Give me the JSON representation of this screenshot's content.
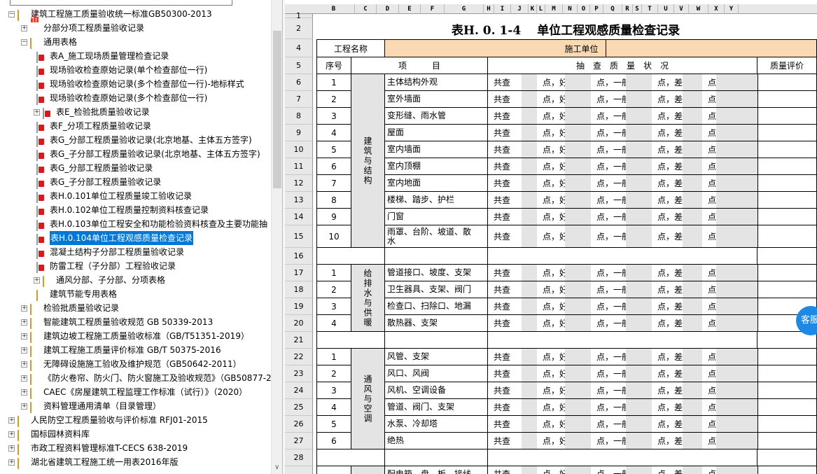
{
  "tree": {
    "toolbar_icons": [
      "search-icon",
      "dropdown-icon"
    ],
    "items": [
      {
        "label": "建筑工程施工质量验收统一标准GB50300-2013",
        "icon": "folder-icon",
        "exp": "−",
        "level": 1
      },
      {
        "label": "分部分项工程质量验收记录",
        "icon": "chart-icon",
        "exp": "+",
        "level": 2
      },
      {
        "label": "通用表格",
        "icon": "folder-icon",
        "exp": "−",
        "level": 2
      },
      {
        "label": "表A_施工现场质量管理检查记录",
        "icon": "pdf-icon",
        "exp": "",
        "level": 3
      },
      {
        "label": "现场验收检查原始记录(单个检查部位一行)",
        "icon": "pdf-icon",
        "exp": "",
        "level": 3
      },
      {
        "label": "现场验收检查原始记录(多个检查部位一行)-地标样式",
        "icon": "pdf-icon",
        "exp": "",
        "level": 3
      },
      {
        "label": "现场验收检查原始记录(多个检查部位一行)",
        "icon": "pdf-icon",
        "exp": "",
        "level": 3
      },
      {
        "label": "表E_检验批质量验收记录",
        "icon": "pdf-icon",
        "exp": "+",
        "level": 3
      },
      {
        "label": "表F_分项工程质量验收记录",
        "icon": "pdf-icon",
        "exp": "",
        "level": 3
      },
      {
        "label": "表G_分部工程质量验收记录(北京地基、主体五方签字)",
        "icon": "pdf-icon",
        "exp": "",
        "level": 3
      },
      {
        "label": "表G_子分部工程质量验收记录(北京地基、主体五方签字)",
        "icon": "pdf-icon",
        "exp": "",
        "level": 3
      },
      {
        "label": "表G_分部工程质量验收记录",
        "icon": "pdf-icon",
        "exp": "",
        "level": 3
      },
      {
        "label": "表G_子分部工程质量验收记录",
        "icon": "pdf-icon",
        "exp": "",
        "level": 3
      },
      {
        "label": "表H.0.101单位工程质量竣工验收记录",
        "icon": "pdf-icon",
        "exp": "",
        "level": 3
      },
      {
        "label": "表H.0.102单位工程质量控制资料核查记录",
        "icon": "pdf-icon",
        "exp": "",
        "level": 3
      },
      {
        "label": "表H.0.103单位工程安全和功能检验资料核查及主要功能抽",
        "icon": "pdf-icon",
        "exp": "",
        "level": 3
      },
      {
        "label": "表H.0.104单位工程观感质量检查记录",
        "icon": "pdf-icon",
        "exp": "",
        "level": 3,
        "selected": true
      },
      {
        "label": "混凝土结构子分部工程质量验收记录",
        "icon": "pdf-icon",
        "exp": "",
        "level": 3
      },
      {
        "label": "防雷工程（子分部）工程验收记录",
        "icon": "pdf-icon",
        "exp": "",
        "level": 3
      },
      {
        "label": "通风分部、子分部、分项表格",
        "icon": "folder-icon",
        "exp": "+",
        "level": 3
      },
      {
        "label": "建筑节能专用表格",
        "icon": "folder-icon",
        "exp": "",
        "level": 3
      },
      {
        "label": "检验批质量验收记录",
        "icon": "folder-icon",
        "exp": "+",
        "level": 2
      },
      {
        "label": "智能建筑工程质量验收规范 GB 50339-2013",
        "icon": "folder-icon",
        "exp": "+",
        "level": 2
      },
      {
        "label": "建筑边坡工程施工质量验收标准（GB/T51351-2019）",
        "icon": "folder-icon",
        "exp": "+",
        "level": 2
      },
      {
        "label": "建筑工程施工质量评价标准 GB/T 50375-2016",
        "icon": "folder-icon",
        "exp": "+",
        "level": 2
      },
      {
        "label": "无障碍设施施工验收及维护规范（GB50642-2011）",
        "icon": "folder-icon",
        "exp": "+",
        "level": 2
      },
      {
        "label": "《防火卷帘、防火门、防火窗施工及验收规范》（GB50877-2",
        "icon": "folder-icon",
        "exp": "+",
        "level": 2
      },
      {
        "label": "CAEC《房屋建筑工程监理工作标准（试行）》（2020）",
        "icon": "folder-icon",
        "exp": "+",
        "level": 2
      },
      {
        "label": "资料管理通用清单（目录管理）",
        "icon": "folder-icon",
        "exp": "+",
        "level": 2
      },
      {
        "label": "人民防空工程质量验收与评价标准 RFJ01-2015",
        "icon": "folder-icon",
        "exp": "+",
        "level": 1
      },
      {
        "label": "国标园林资料库",
        "icon": "folder-icon",
        "exp": "+",
        "level": 1
      },
      {
        "label": "市政工程资料管理标准T-CECS 638-2019",
        "icon": "folder-icon",
        "exp": "+",
        "level": 1
      },
      {
        "label": "湖北省建筑工程施工统一用表2016年版",
        "icon": "folder-icon",
        "exp": "+",
        "level": 1
      }
    ]
  },
  "sheet": {
    "columns": [
      "B",
      "C",
      "D",
      "E",
      "F",
      "G",
      "H",
      "I",
      "J",
      "K",
      "L",
      "M",
      "N",
      "O",
      "P",
      "Q",
      "R",
      "S",
      "T",
      "U",
      "V",
      "W",
      "X",
      "Y"
    ],
    "title": "表H. 0. 1-4　 单位工程观感质量检查记录",
    "project_name_label": "工程名称",
    "contractor_label": "施工单位",
    "headers": {
      "seq": "序号",
      "item": "项　　　目",
      "check": "抽　查　质　量　状　况",
      "rating": "质量评价"
    },
    "check_words": {
      "total": "共查",
      "good": "点，好",
      "ok": "点，一般",
      "bad": "点，差",
      "end": "点"
    },
    "groups": [
      {
        "name": "建筑与结构",
        "rows": [
          {
            "r": "6",
            "n": "1",
            "item": "主体结构外观"
          },
          {
            "r": "7",
            "n": "2",
            "item": "室外墙面"
          },
          {
            "r": "8",
            "n": "3",
            "item": "变形缝、雨水管"
          },
          {
            "r": "9",
            "n": "4",
            "item": "屋面"
          },
          {
            "r": "10",
            "n": "5",
            "item": "室内墙面"
          },
          {
            "r": "11",
            "n": "6",
            "item": "室内顶棚"
          },
          {
            "r": "12",
            "n": "7",
            "item": "室内地面"
          },
          {
            "r": "13",
            "n": "8",
            "item": "楼梯、踏步、护栏"
          },
          {
            "r": "14",
            "n": "9",
            "item": "门窗"
          },
          {
            "r": "15",
            "n": "10",
            "item": "雨罩、台阶、坡道、散",
            "item2": "水"
          }
        ]
      },
      {
        "name": "给排水与供暖",
        "rows": [
          {
            "r": "17",
            "n": "1",
            "item": "管道接口、坡度、支架"
          },
          {
            "r": "18",
            "n": "2",
            "item": "卫生器具、支架、阀门"
          },
          {
            "r": "19",
            "n": "3",
            "item": "检查口、扫除口、地漏"
          },
          {
            "r": "20",
            "n": "4",
            "item": "散热器、支架"
          }
        ]
      },
      {
        "name": "通风与空调",
        "rows": [
          {
            "r": "22",
            "n": "1",
            "item": "风管、支架"
          },
          {
            "r": "23",
            "n": "2",
            "item": "风口、风阀"
          },
          {
            "r": "24",
            "n": "3",
            "item": "风机、空调设备"
          },
          {
            "r": "25",
            "n": "4",
            "item": "管道、阀门、支架"
          },
          {
            "r": "26",
            "n": "5",
            "item": "水泵、冷却塔"
          },
          {
            "r": "27",
            "n": "6",
            "item": "绝热"
          }
        ]
      }
    ],
    "row_labels": {
      "r1": "1",
      "r2": "2",
      "r4": "4",
      "r5": "5",
      "r16": "16",
      "r21": "21",
      "r28": "28"
    },
    "partial_row_item": "配电箱、盘、板、接线"
  },
  "chat": {
    "label": "客服"
  }
}
